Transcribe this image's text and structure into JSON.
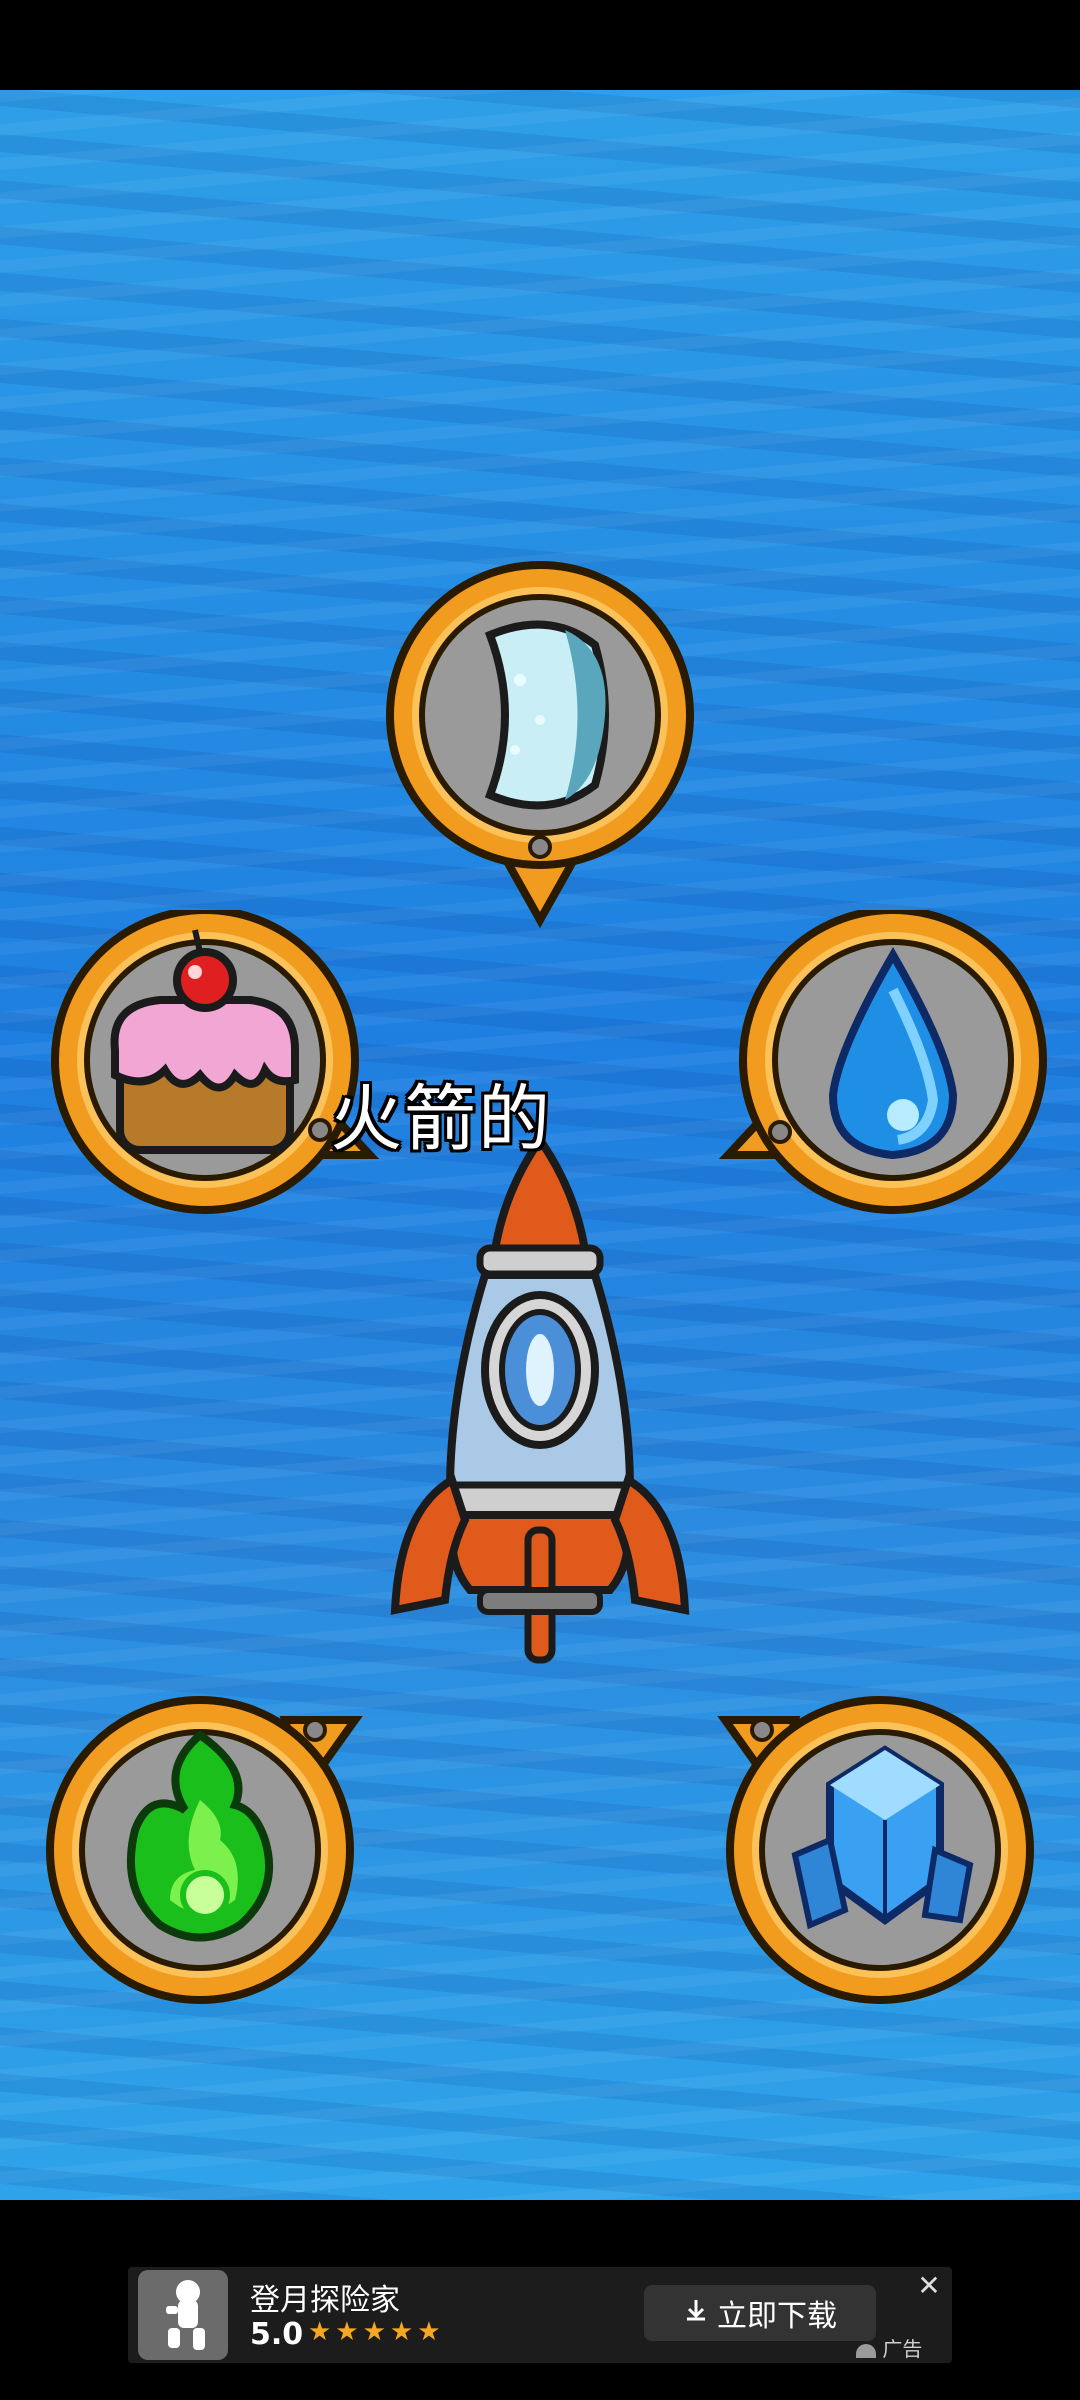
{
  "game": {
    "title_text": "火箭的",
    "colors": {
      "sky": "#1e7fe0",
      "bubble_border": "#f29c1f",
      "bubble_fill": "#9a9a9a",
      "rocket_body": "#a9c9e6",
      "rocket_red": "#e05a1c"
    },
    "ingredients": [
      {
        "name": "bean-icon",
        "slot": "top"
      },
      {
        "name": "cake-icon",
        "slot": "left"
      },
      {
        "name": "water-drop-icon",
        "slot": "right"
      },
      {
        "name": "green-flame-icon",
        "slot": "bottom-left"
      },
      {
        "name": "ice-crystal-icon",
        "slot": "bottom-right"
      }
    ]
  },
  "ad": {
    "app_name": "登月探险家",
    "rating": "5.0",
    "stars": "★★★★★",
    "download_label": "立即下载",
    "download_icon": "download-icon",
    "close_icon": "close-icon",
    "tag": "广告"
  }
}
